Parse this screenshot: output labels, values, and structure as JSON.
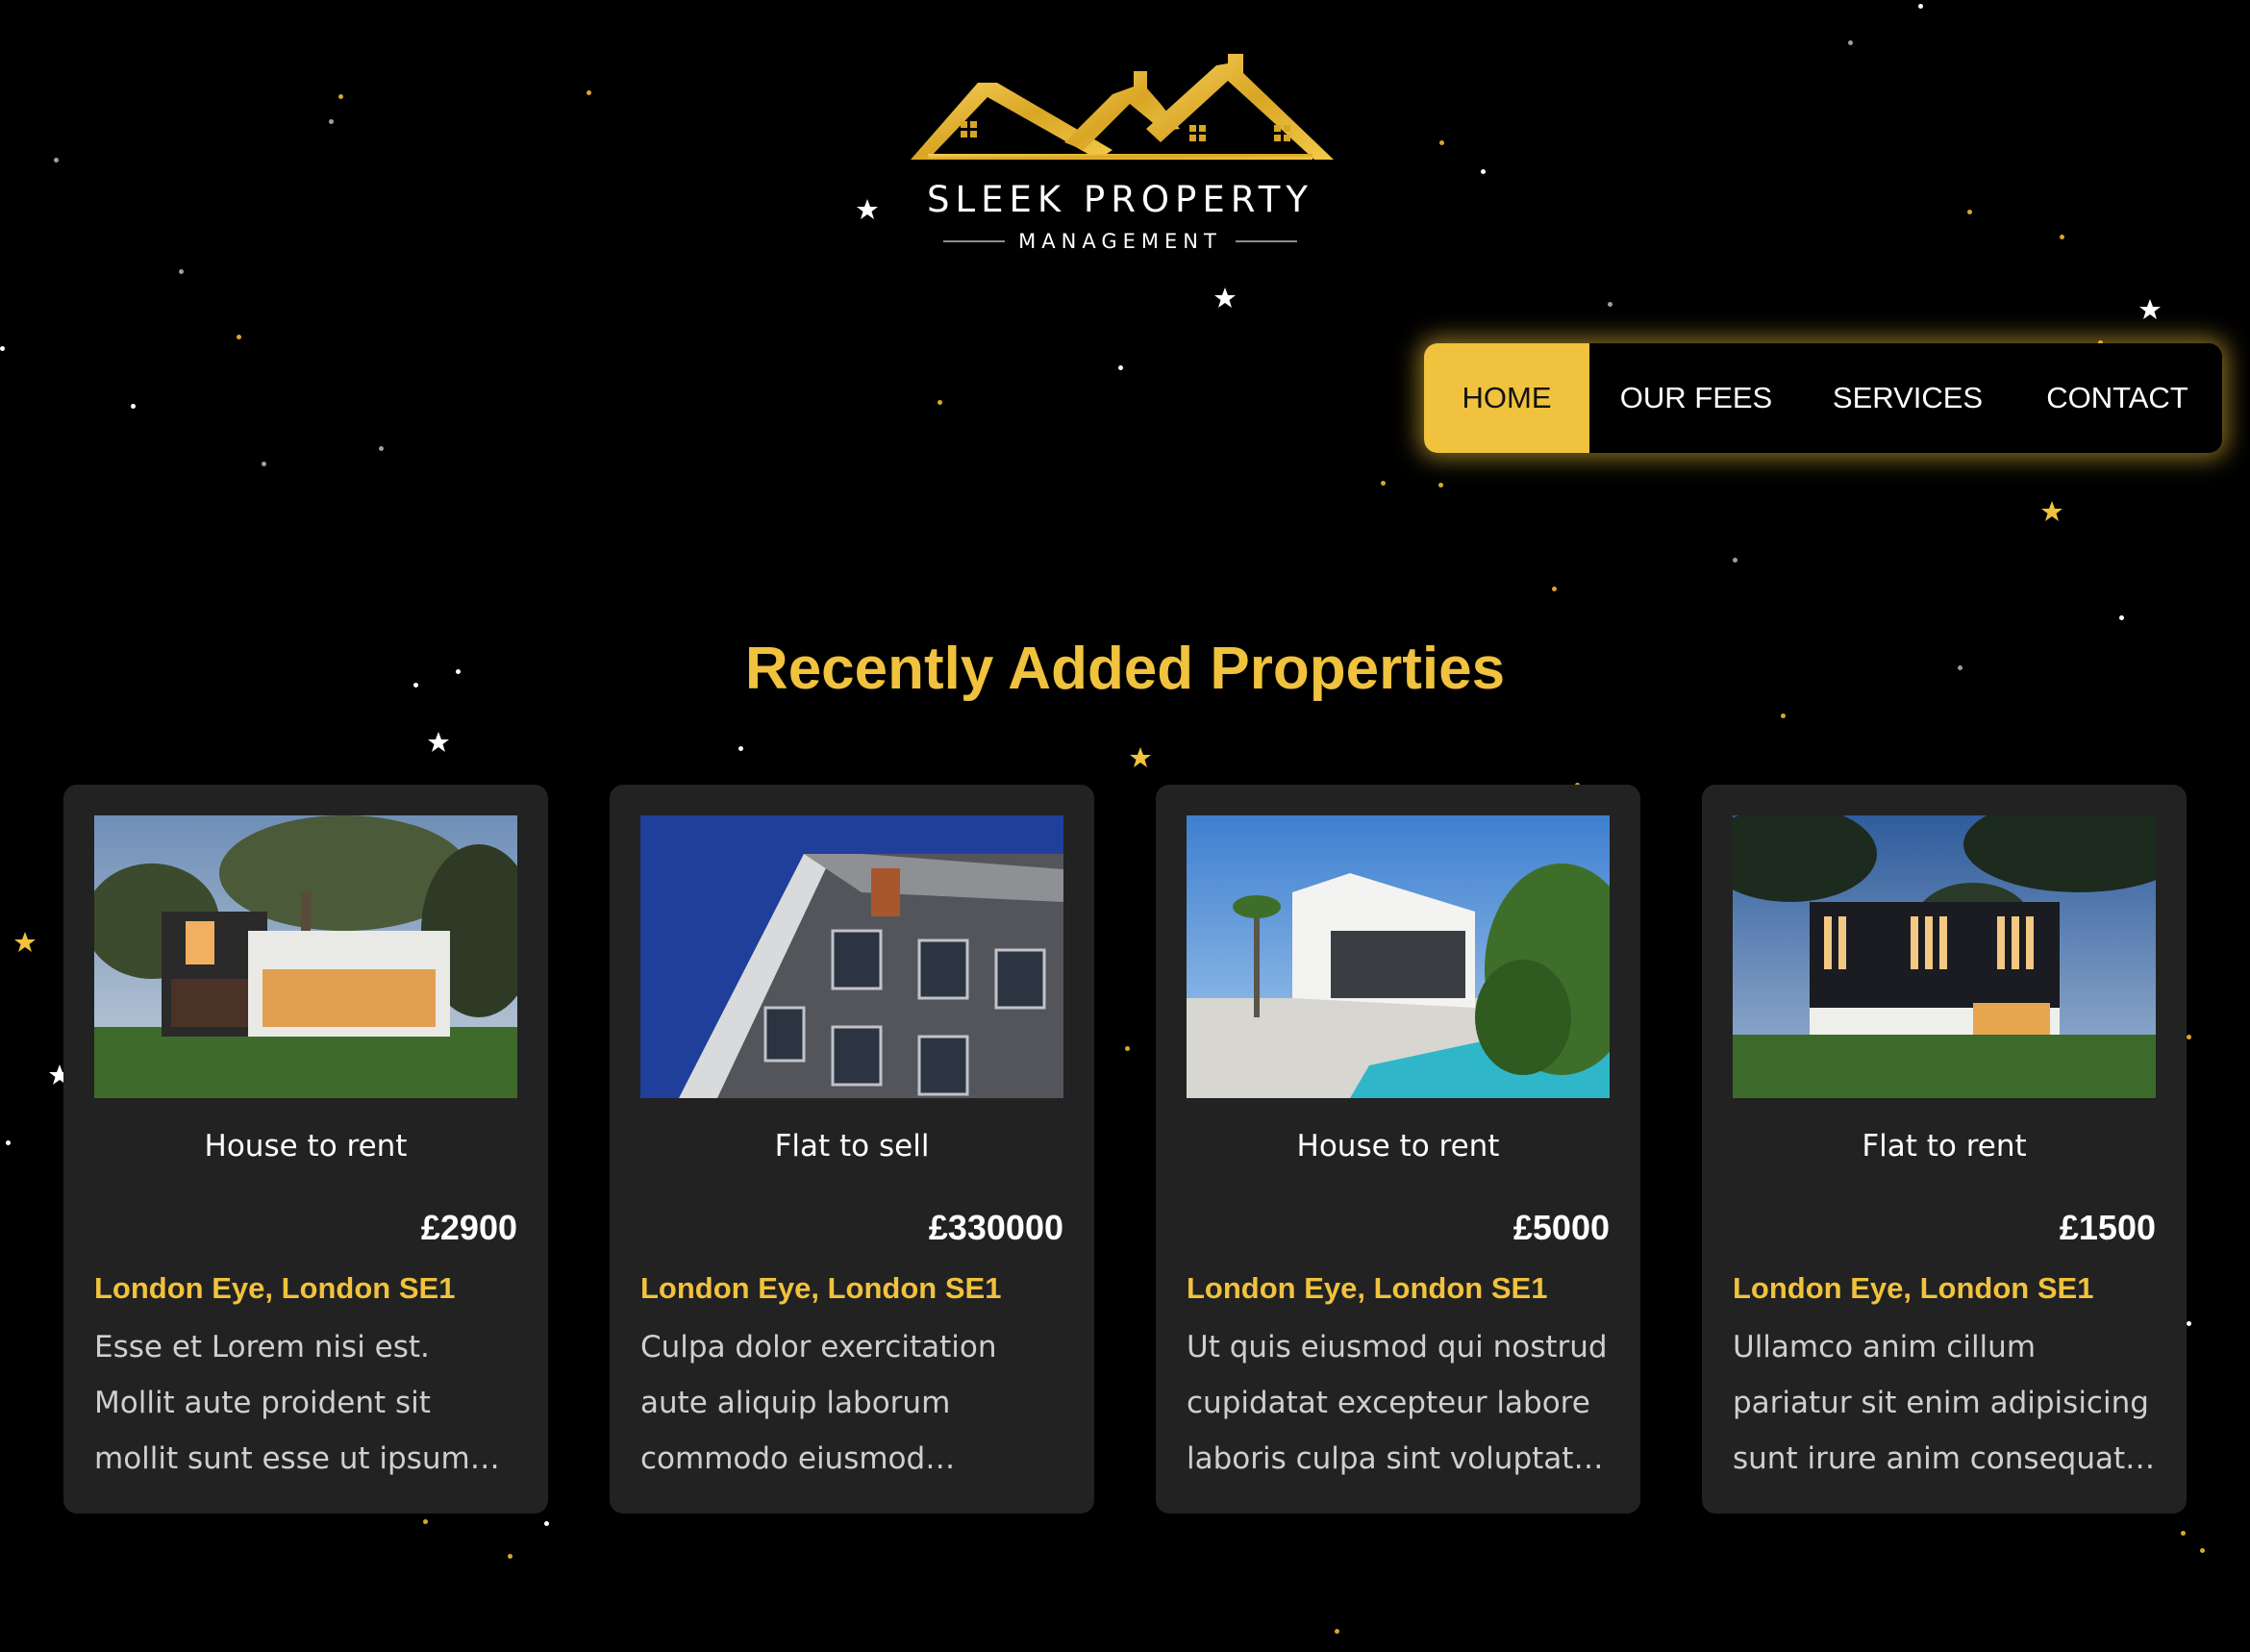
{
  "brand": {
    "name": "SLEEK PROPERTY",
    "tagline": "MANAGEMENT",
    "logo_icon": "house-roofs-logo",
    "accent_color": "#f0c23d"
  },
  "nav": {
    "items": [
      {
        "label": "HOME",
        "active": true
      },
      {
        "label": "OUR FEES",
        "active": false
      },
      {
        "label": "SERVICES",
        "active": false
      },
      {
        "label": "CONTACT",
        "active": false
      }
    ]
  },
  "main": {
    "heading": "Recently Added Properties",
    "properties": [
      {
        "image": "modern-house-with-tree-photo",
        "type": "House to rent",
        "price": "£2900",
        "location": "London Eye, London SE1",
        "description": "Esse et Lorem nisi est. Mollit aute proident sit mollit sunt esse ut ipsum tempor duis. Lorem ipsum dolor sit amet consectetur."
      },
      {
        "image": "apartment-building-blue-sky-photo",
        "type": "Flat to sell",
        "price": "£330000",
        "location": "London Eye, London SE1",
        "description": "Culpa dolor exercitation aute aliquip laborum commodo eiusmod incididunt nulla ex ea commodo consequat."
      },
      {
        "image": "white-villa-with-pool-photo",
        "type": "House to rent",
        "price": "£5000",
        "location": "London Eye, London SE1",
        "description": "Ut quis eiusmod qui nostrud cupidatat excepteur labore laboris culpa sint voluptate velit esse cillum."
      },
      {
        "image": "dark-modern-house-dusk-photo",
        "type": "Flat to rent",
        "price": "£1500",
        "location": "London Eye, London SE1",
        "description": "Ullamco anim cillum pariatur sit enim adipisicing sunt irure anim consequat ipsum mollit id est laborum."
      }
    ]
  }
}
